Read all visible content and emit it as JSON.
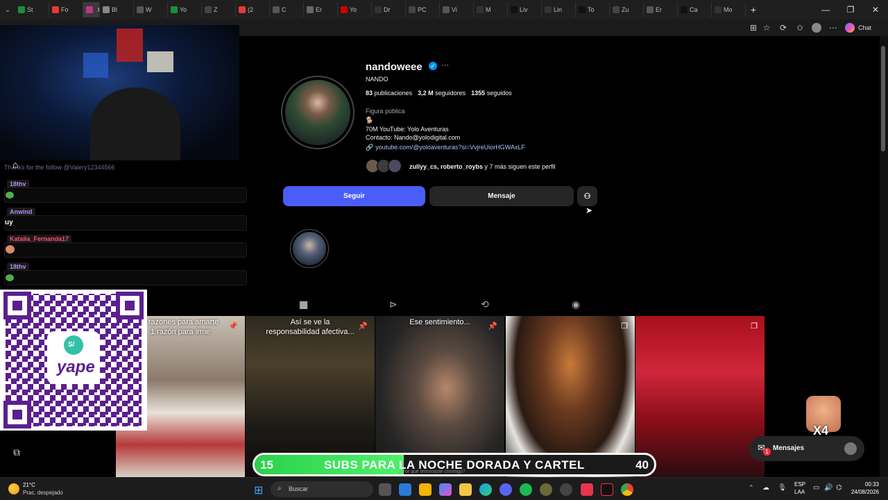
{
  "browser": {
    "tabs": [
      "St",
      "Fo",
      "",
      "Bl",
      "W",
      "Yo",
      "Z",
      "(2",
      "C",
      "Er",
      "Yo",
      "Dr",
      "PC",
      "Vi",
      "M",
      "Liv",
      "Lin",
      "To",
      "Zu",
      "Er",
      "Ca",
      "Mo"
    ],
    "new_tab": "+",
    "copilot_label": "Chat"
  },
  "profile": {
    "username": "nandoweee",
    "full_name": "NANDO",
    "posts_count": "83",
    "posts_label": "publicaciones",
    "followers_count": "3,2 M",
    "followers_label": "seguidores",
    "following_count": "1355",
    "following_label": "seguidos",
    "category": "Figura pública",
    "bio_emoji": "🐕",
    "bio_line1": "70M YouTube: Yolo Aventuras",
    "bio_line2": "Contacto: Nando@yolodigital.com",
    "link": "youtube.com/@yoloaventuras?si=VvjreUiorHGWAxLF",
    "followed_by_names": "zullyy_cs, roberto_roybs",
    "followed_by_rest": " y 7 más siguen este perfil",
    "follow_button": "Seguir",
    "message_button": "Mensaje"
  },
  "posts": [
    {
      "caption": "3 razones para amarte\n1 razón para irme"
    },
    {
      "caption": "Así se ve la\nresponsabilidad afectiva..."
    },
    {
      "caption": "Ese sentimiento..."
    },
    {
      "caption": ""
    },
    {
      "caption": ""
    }
  ],
  "stream": {
    "chat": [
      {
        "user": "18thv",
        "msg": ""
      },
      {
        "user": "Anwind",
        "msg": "uy"
      },
      {
        "user": "Katalia_Fernanda17",
        "msg": ""
      },
      {
        "user": "18thv",
        "msg": ""
      }
    ],
    "ghost_text": "Thanks for the follow @Valery12344566",
    "qr_brand": "yape",
    "qr_symbol": "S/",
    "banner_left": "15",
    "banner_text": "SUBS PARA LA NOCHE DORADA Y CARTEL",
    "banner_right": "40",
    "banner_sub": "¿Por qué terminaste conmigo?",
    "x4": "X4"
  },
  "messages_label": "Mensajes",
  "messages_badge": "1",
  "taskbar": {
    "weather_temp": "21°C",
    "weather_desc": "Prac. despejado",
    "search_placeholder": "Buscar",
    "lang1": "ESP",
    "lang2": "LAA",
    "time": "00:33",
    "date": "24/08/2026"
  },
  "colors": {
    "accent": "#4a5df9",
    "link": "#a8c7fa",
    "verified": "#0095f6"
  }
}
